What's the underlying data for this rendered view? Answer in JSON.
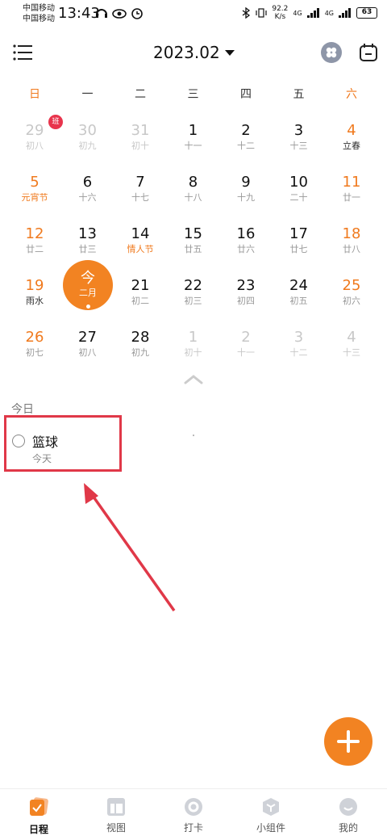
{
  "status_bar": {
    "carrier_1": "中国移动",
    "carrier_2": "中国移动",
    "time": "13:43",
    "speed_value": "92.2",
    "speed_unit": "K/s",
    "net_1": "4G",
    "net_2": "4G",
    "battery": "63"
  },
  "header": {
    "month": "2023.02"
  },
  "weekdays": [
    "日",
    "一",
    "二",
    "三",
    "四",
    "五",
    "六"
  ],
  "weeks": [
    [
      {
        "d": "29",
        "l": "初八",
        "dim": true
      },
      {
        "d": "30",
        "l": "初九",
        "dim": true
      },
      {
        "d": "31",
        "l": "初十",
        "dim": true
      },
      {
        "d": "1",
        "l": "十一"
      },
      {
        "d": "2",
        "l": "十二"
      },
      {
        "d": "3",
        "l": "十三"
      },
      {
        "d": "4",
        "l": "立春",
        "term": true
      }
    ],
    [
      {
        "d": "5",
        "l": "元宵节",
        "hl": true
      },
      {
        "d": "6",
        "l": "十六"
      },
      {
        "d": "7",
        "l": "十七"
      },
      {
        "d": "8",
        "l": "十八"
      },
      {
        "d": "9",
        "l": "十九"
      },
      {
        "d": "10",
        "l": "二十"
      },
      {
        "d": "11",
        "l": "廿一"
      }
    ],
    [
      {
        "d": "12",
        "l": "廿二"
      },
      {
        "d": "13",
        "l": "廿三"
      },
      {
        "d": "14",
        "l": "情人节",
        "hl": true
      },
      {
        "d": "15",
        "l": "廿五"
      },
      {
        "d": "16",
        "l": "廿六"
      },
      {
        "d": "17",
        "l": "廿七"
      },
      {
        "d": "18",
        "l": "廿八"
      }
    ],
    [
      {
        "d": "19",
        "l": "雨水",
        "term": true
      },
      {
        "d": "今",
        "l": "二月",
        "today": true
      },
      {
        "d": "21",
        "l": "初二"
      },
      {
        "d": "22",
        "l": "初三"
      },
      {
        "d": "23",
        "l": "初四"
      },
      {
        "d": "24",
        "l": "初五"
      },
      {
        "d": "25",
        "l": "初六"
      }
    ],
    [
      {
        "d": "26",
        "l": "初七"
      },
      {
        "d": "27",
        "l": "初八"
      },
      {
        "d": "28",
        "l": "初九"
      },
      {
        "d": "1",
        "l": "初十",
        "dim": true
      },
      {
        "d": "2",
        "l": "十一",
        "dim": true
      },
      {
        "d": "3",
        "l": "十二",
        "dim": true
      },
      {
        "d": "4",
        "l": "十三",
        "dim": true
      }
    ]
  ],
  "badge": "班",
  "today_section": {
    "title": "今日",
    "task_title": "篮球",
    "task_date": "今天"
  },
  "nav": [
    {
      "label": "日程"
    },
    {
      "label": "视图"
    },
    {
      "label": "打卡"
    },
    {
      "label": "小组件"
    },
    {
      "label": "我的"
    }
  ],
  "colors": {
    "accent": "#f28322",
    "weekend": "#f07a1e",
    "annotation": "#e03848"
  }
}
